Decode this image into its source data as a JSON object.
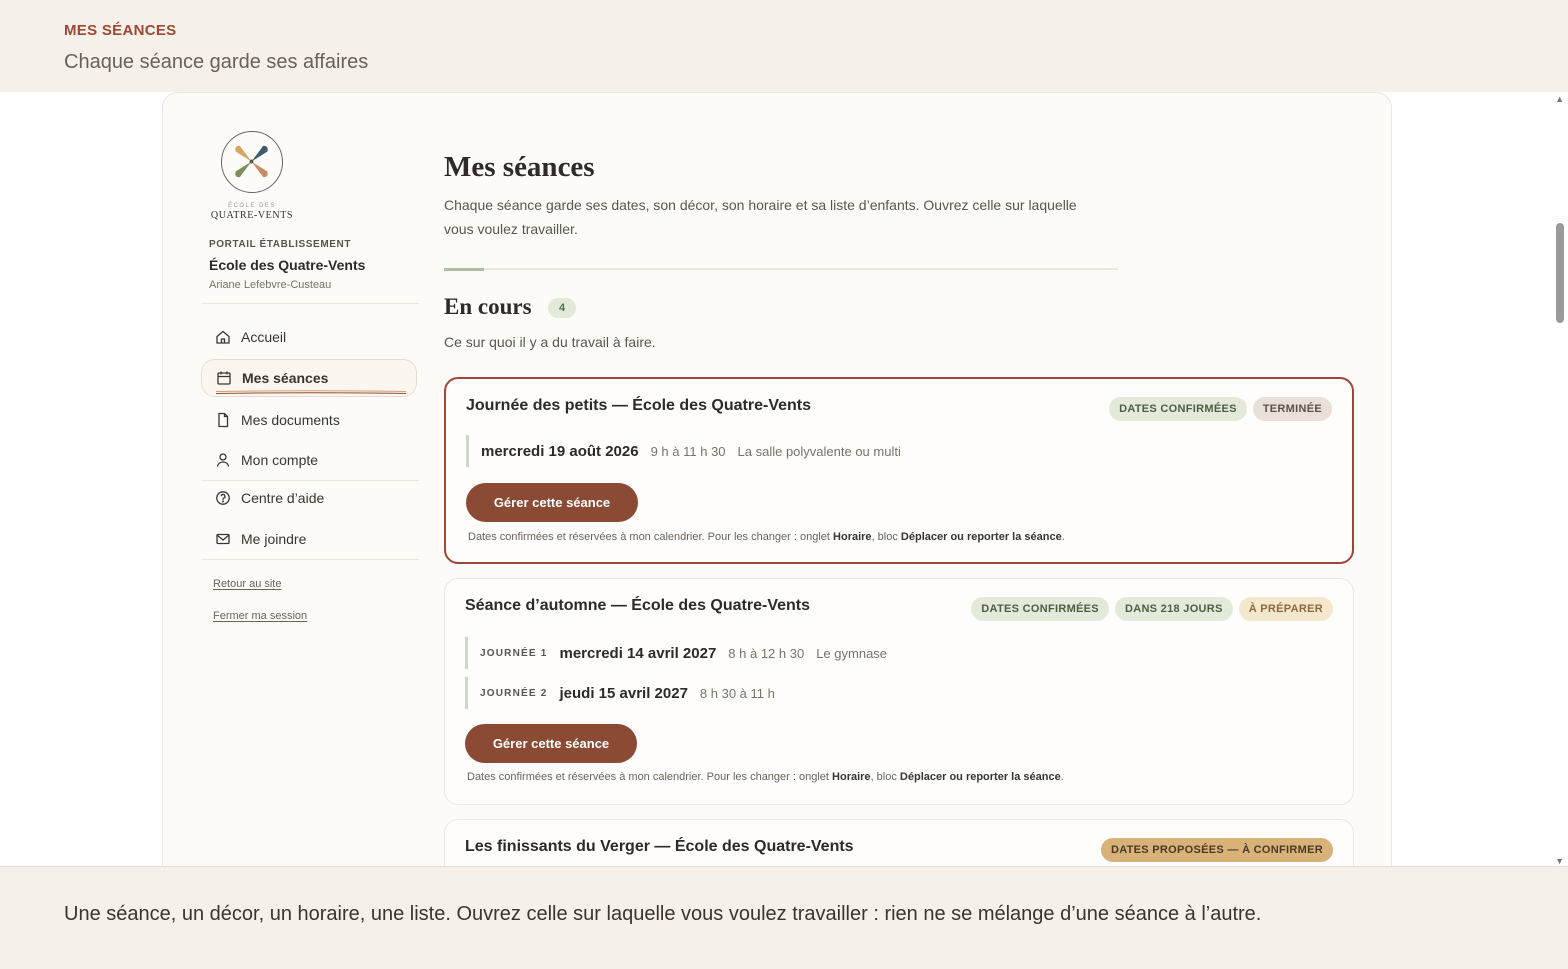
{
  "banner": {
    "eyebrow": "MES SÉANCES",
    "subtitle": "Chaque séance garde ses affaires"
  },
  "sidebar": {
    "logo_small": "ÉCOLE DES",
    "logo_name": "QUATRE-VENTS",
    "portal_label": "PORTAIL ÉTABLISSEMENT",
    "school_name": "École des Quatre-Vents",
    "user_name": "Ariane Lefebvre-Custeau",
    "nav": [
      {
        "label": "Accueil",
        "icon": "home-icon"
      },
      {
        "label": "Mes séances",
        "icon": "calendar-icon",
        "active": true
      },
      {
        "label": "Mes documents",
        "icon": "document-icon"
      },
      {
        "label": "Mon compte",
        "icon": "user-icon"
      },
      {
        "label": "Centre d’aide",
        "icon": "help-icon"
      },
      {
        "label": "Me joindre",
        "icon": "mail-icon"
      }
    ],
    "links": [
      "Retour au site",
      "Fermer ma session"
    ]
  },
  "main": {
    "title": "Mes séances",
    "description": "Chaque séance garde ses dates, son décor, son horaire et sa liste d’enfants. Ouvrez celle sur laquelle vous voulez travailler.",
    "section": {
      "title": "En cours",
      "count": "4",
      "description": "Ce sur quoi il y a du travail à faire."
    },
    "button_label": "Gérer cette séance",
    "note": {
      "prefix": "Dates confirmées et réservées à mon calendrier. Pour les changer : onglet ",
      "tab": "Horaire",
      "middle": ", bloc ",
      "block": "Déplacer ou reporter la séance",
      "suffix": "."
    },
    "cards": [
      {
        "title": "Journée des petits — École des Quatre-Vents",
        "badges": [
          "DATES CONFIRMÉES",
          "TERMINÉE"
        ],
        "days": [
          {
            "label": "",
            "date": "mercredi 19 août 2026",
            "time": "9 h à 11 h 30",
            "place": "La salle polyvalente ou multi"
          }
        ]
      },
      {
        "title": "Séance d’automne — École des Quatre-Vents",
        "badges": [
          "DATES CONFIRMÉES",
          "DANS 218 JOURS",
          "À PRÉPARER"
        ],
        "days": [
          {
            "label": "JOURNÉE 1",
            "date": "mercredi 14 avril 2027",
            "time": "8 h à 12 h 30",
            "place": "Le gymnase"
          },
          {
            "label": "JOURNÉE 2",
            "date": "jeudi 15 avril 2027",
            "time": "8 h 30 à 11 h",
            "place": ""
          }
        ]
      },
      {
        "title": "Les finissants du Verger — École des Quatre-Vents",
        "badges": [
          "DATES PROPOSÉES — À CONFIRMER"
        ]
      }
    ]
  },
  "footer": {
    "text": "Une séance, un décor, un horaire, une liste. Ouvrez celle sur laquelle vous voulez travailler : rien ne se mélange d’une séance à l’autre."
  },
  "colors": {
    "accent": "#8a4a34",
    "selected_border": "#a3443a",
    "eyebrow": "#9a4a32",
    "badge_green": "#e3ead9",
    "badge_gold": "#d9b27a"
  }
}
